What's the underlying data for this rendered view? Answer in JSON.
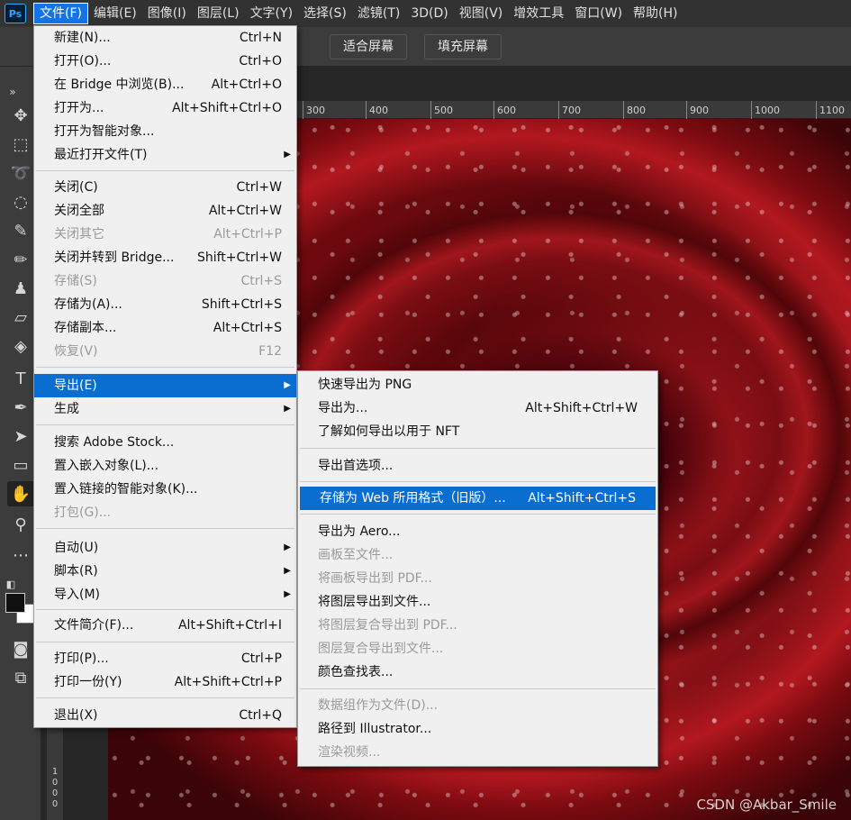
{
  "menubar": {
    "logo": "Ps",
    "items": [
      "文件(F)",
      "编辑(E)",
      "图像(I)",
      "图层(L)",
      "文字(Y)",
      "选择(S)",
      "滤镜(T)",
      "3D(D)",
      "视图(V)",
      "增效工具",
      "窗口(W)",
      "帮助(H)"
    ]
  },
  "optbar": {
    "fit_screen": "适合屏幕",
    "fill_screen": "填充屏幕"
  },
  "ruler": {
    "top_ticks": [
      "300",
      "400",
      "500",
      "600",
      "700",
      "800",
      "900",
      "1000",
      "1100"
    ],
    "left_digits": [
      "1",
      "0",
      "0",
      "0"
    ]
  },
  "file_menu": {
    "items": [
      {
        "label": "新建(N)...",
        "shortcut": "Ctrl+N"
      },
      {
        "label": "打开(O)...",
        "shortcut": "Ctrl+O"
      },
      {
        "label": "在 Bridge 中浏览(B)...",
        "shortcut": "Alt+Ctrl+O"
      },
      {
        "label": "打开为...",
        "shortcut": "Alt+Shift+Ctrl+O"
      },
      {
        "label": "打开为智能对象...",
        "shortcut": ""
      },
      {
        "label": "最近打开文件(T)",
        "shortcut": ""
      },
      {
        "label": "关闭(C)",
        "shortcut": "Ctrl+W"
      },
      {
        "label": "关闭全部",
        "shortcut": "Alt+Ctrl+W"
      },
      {
        "label": "关闭其它",
        "shortcut": "Alt+Ctrl+P"
      },
      {
        "label": "关闭并转到 Bridge...",
        "shortcut": "Shift+Ctrl+W"
      },
      {
        "label": "存储(S)",
        "shortcut": "Ctrl+S"
      },
      {
        "label": "存储为(A)...",
        "shortcut": "Shift+Ctrl+S"
      },
      {
        "label": "存储副本...",
        "shortcut": "Alt+Ctrl+S"
      },
      {
        "label": "恢复(V)",
        "shortcut": "F12"
      },
      {
        "label": "导出(E)",
        "shortcut": ""
      },
      {
        "label": "生成",
        "shortcut": ""
      },
      {
        "label": "搜索 Adobe Stock...",
        "shortcut": ""
      },
      {
        "label": "置入嵌入对象(L)...",
        "shortcut": ""
      },
      {
        "label": "置入链接的智能对象(K)...",
        "shortcut": ""
      },
      {
        "label": "打包(G)...",
        "shortcut": ""
      },
      {
        "label": "自动(U)",
        "shortcut": ""
      },
      {
        "label": "脚本(R)",
        "shortcut": ""
      },
      {
        "label": "导入(M)",
        "shortcut": ""
      },
      {
        "label": "文件简介(F)...",
        "shortcut": "Alt+Shift+Ctrl+I"
      },
      {
        "label": "打印(P)...",
        "shortcut": "Ctrl+P"
      },
      {
        "label": "打印一份(Y)",
        "shortcut": "Alt+Shift+Ctrl+P"
      },
      {
        "label": "退出(X)",
        "shortcut": "Ctrl+Q"
      }
    ]
  },
  "export_menu": {
    "items": [
      {
        "label": "快速导出为 PNG",
        "shortcut": ""
      },
      {
        "label": "导出为...",
        "shortcut": "Alt+Shift+Ctrl+W"
      },
      {
        "label": "了解如何导出以用于 NFT",
        "shortcut": ""
      },
      {
        "label": "导出首选项...",
        "shortcut": ""
      },
      {
        "label": "存储为 Web 所用格式（旧版）...",
        "shortcut": "Alt+Shift+Ctrl+S"
      },
      {
        "label": "导出为 Aero...",
        "shortcut": ""
      },
      {
        "label": "画板至文件...",
        "shortcut": ""
      },
      {
        "label": "将画板导出到 PDF...",
        "shortcut": ""
      },
      {
        "label": "将图层导出到文件...",
        "shortcut": ""
      },
      {
        "label": "将图层复合导出到 PDF...",
        "shortcut": ""
      },
      {
        "label": "图层复合导出到文件...",
        "shortcut": ""
      },
      {
        "label": "颜色查找表...",
        "shortcut": ""
      },
      {
        "label": "数据组作为文件(D)...",
        "shortcut": ""
      },
      {
        "label": "路径到 Illustrator...",
        "shortcut": ""
      },
      {
        "label": "渲染视频...",
        "shortcut": ""
      }
    ]
  },
  "watermark": "CSDN @Akbar_Smile"
}
